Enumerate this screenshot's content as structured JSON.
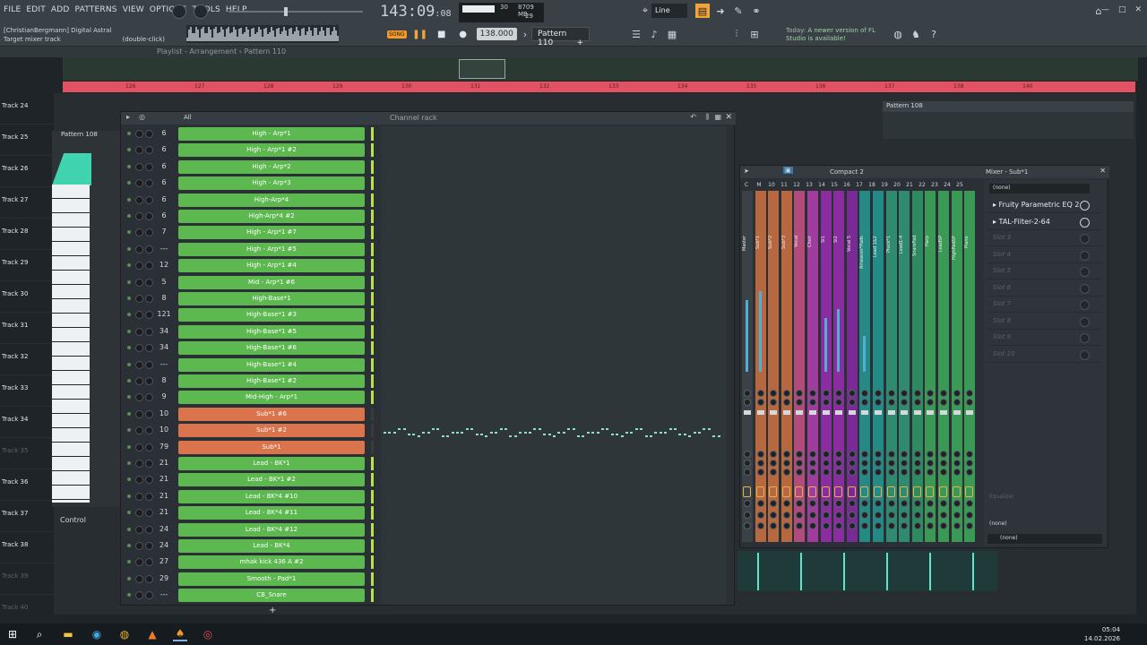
{
  "menu": [
    "FILE",
    "EDIT",
    "ADD",
    "PATTERNS",
    "VIEW",
    "OPTIONS",
    "TOOLS",
    "HELP"
  ],
  "hint": {
    "line1": "[ChristianBergmann] Digital Astral",
    "line2": "Target mixer track",
    "line3": "(double-click)"
  },
  "clock": {
    "main": "143:09",
    "sub": ":08"
  },
  "cpu": {
    "mb": "8709 MB",
    "poly": "29",
    "cpuval": "30"
  },
  "transport": {
    "song": "SONG",
    "tempo": "138.000",
    "pattern": "Pattern 110"
  },
  "snap": "Line",
  "news": {
    "l1": "Today:",
    "l2": "A newer version of FL Studio is available!"
  },
  "playlist": {
    "title": "Playlist - Arrangement › Pattern 110"
  },
  "ruler": [
    "126",
    "127",
    "128",
    "129",
    "130",
    "131",
    "132",
    "133",
    "134",
    "135",
    "136",
    "137",
    "138",
    "140"
  ],
  "tracks": [
    "Track 24",
    "Track 25",
    "Track 26",
    "Track 27",
    "Track 28",
    "Track 29",
    "Track 30",
    "Track 31",
    "Track 32",
    "Track 33",
    "Track 34",
    "Track 35",
    "Track 36",
    "Track 37",
    "Track 38",
    "Track 39",
    "Track 40"
  ],
  "arrangement": {
    "pattern108": "Pattern 108"
  },
  "piano": {
    "header": "Pattern 108",
    "control": "Control"
  },
  "channelrack": {
    "title": "Channel rack",
    "filter": "All",
    "channels": [
      {
        "num": "6",
        "name": "High - Arp*1",
        "color": "#5cb84f"
      },
      {
        "num": "6",
        "name": "High - Arp*1 #2",
        "color": "#5cb84f"
      },
      {
        "num": "6",
        "name": "High - Arp*2",
        "color": "#5cb84f"
      },
      {
        "num": "6",
        "name": "High - Arp*3",
        "color": "#5cb84f"
      },
      {
        "num": "6",
        "name": "High-Arp*4",
        "color": "#5cb84f"
      },
      {
        "num": "6",
        "name": "High-Arp*4 #2",
        "color": "#5cb84f"
      },
      {
        "num": "7",
        "name": "High - Arp*1 #7",
        "color": "#5cb84f"
      },
      {
        "num": "---",
        "name": "High - Arp*1 #5",
        "color": "#5cb84f"
      },
      {
        "num": "12",
        "name": "High - Arp*1 #4",
        "color": "#5cb84f"
      },
      {
        "num": "5",
        "name": "Mid - Arp*1 #6",
        "color": "#5cb84f"
      },
      {
        "num": "8",
        "name": "High-Base*1",
        "color": "#5cb84f"
      },
      {
        "num": "121",
        "name": "High-Base*1 #3",
        "color": "#5cb84f"
      },
      {
        "num": "34",
        "name": "High-Base*1 #5",
        "color": "#5cb84f"
      },
      {
        "num": "34",
        "name": "High-Base*1 #6",
        "color": "#5cb84f"
      },
      {
        "num": "---",
        "name": "High-Base*1 #4",
        "color": "#5cb84f"
      },
      {
        "num": "8",
        "name": "High-Base*1 #2",
        "color": "#5cb84f"
      },
      {
        "num": "9",
        "name": "Mid-High - Arp*1",
        "color": "#5cb84f"
      },
      {
        "num": "10",
        "name": "Sub*1 #6",
        "color": "#d9744d"
      },
      {
        "num": "10",
        "name": "Sub*1 #2",
        "color": "#d9744d"
      },
      {
        "num": "79",
        "name": "Sub*1",
        "color": "#d9744d"
      },
      {
        "num": "21",
        "name": "Lead - BK*1",
        "color": "#5cb84f"
      },
      {
        "num": "21",
        "name": "Lead - BK*1 #2",
        "color": "#5cb84f"
      },
      {
        "num": "21",
        "name": "Lead - BK*4 #10",
        "color": "#5cb84f"
      },
      {
        "num": "21",
        "name": "Lead - BK*4 #11",
        "color": "#5cb84f"
      },
      {
        "num": "24",
        "name": "Lead - BK*4 #12",
        "color": "#5cb84f"
      },
      {
        "num": "24",
        "name": "Lead - BK*4",
        "color": "#5cb84f"
      },
      {
        "num": "27",
        "name": "mhak kick 436 A #2",
        "color": "#5cb84f"
      },
      {
        "num": "29",
        "name": "Smooth - Pad*1",
        "color": "#5cb84f"
      },
      {
        "num": "---",
        "name": "CB_Snare",
        "color": "#5cb84f"
      }
    ]
  },
  "mixer": {
    "title": "Compact 2",
    "inspector_title": "Mixer - Sub*1",
    "numbers": [
      "C",
      "M",
      "10",
      "11",
      "12",
      "13",
      "14",
      "15",
      "16",
      "17",
      "18",
      "19",
      "20",
      "21",
      "22",
      "23",
      "24",
      "25"
    ],
    "strips": [
      {
        "name": "Master",
        "color": "#3b4247"
      },
      {
        "name": "Sub*1",
        "color": "#b8683e"
      },
      {
        "name": "Sub*2",
        "color": "#b8683e"
      },
      {
        "name": "Sub*3",
        "color": "#b8683e"
      },
      {
        "name": "Vocal",
        "color": "#b04b7c"
      },
      {
        "name": "Choir",
        "color": "#a13c9e"
      },
      {
        "name": "SI1",
        "color": "#8a2d9e"
      },
      {
        "name": "SI2",
        "color": "#8a2d9e"
      },
      {
        "name": "Vocal 5",
        "color": "#7a2a95"
      },
      {
        "name": "Airwaves*Pads",
        "color": "#238a86"
      },
      {
        "name": "Lead 1&2",
        "color": "#238a86"
      },
      {
        "name": "Pluck*1",
        "color": "#2e8b70"
      },
      {
        "name": "Lead1-4",
        "color": "#2e8b70"
      },
      {
        "name": "SnarePad",
        "color": "#2e8b60"
      },
      {
        "name": "Harp",
        "color": "#3a9a55"
      },
      {
        "name": "LeadSP",
        "color": "#3a9a55"
      },
      {
        "name": "HighPadSP",
        "color": "#3a9a55"
      },
      {
        "name": "Piano",
        "color": "#3a9a55"
      }
    ],
    "inspector": {
      "input": "(none)",
      "slots": [
        "Fruity Parametric EQ 2",
        "TAL-Filter-2-64",
        "Slot 3",
        "Slot 4",
        "Slot 5",
        "Slot 6",
        "Slot 7",
        "Slot 8",
        "Slot 9",
        "Slot 10"
      ],
      "eq_label": "Equalizer",
      "out1": "(none)",
      "out2": "(none)"
    }
  },
  "tray": {
    "time": "05:04",
    "date": "14.02.2026"
  },
  "icons": [
    "windows-icon",
    "search-icon",
    "folder-icon",
    "edge-icon",
    "chrome-icon",
    "vlc-icon",
    "fl-studio-icon",
    "record-icon"
  ]
}
